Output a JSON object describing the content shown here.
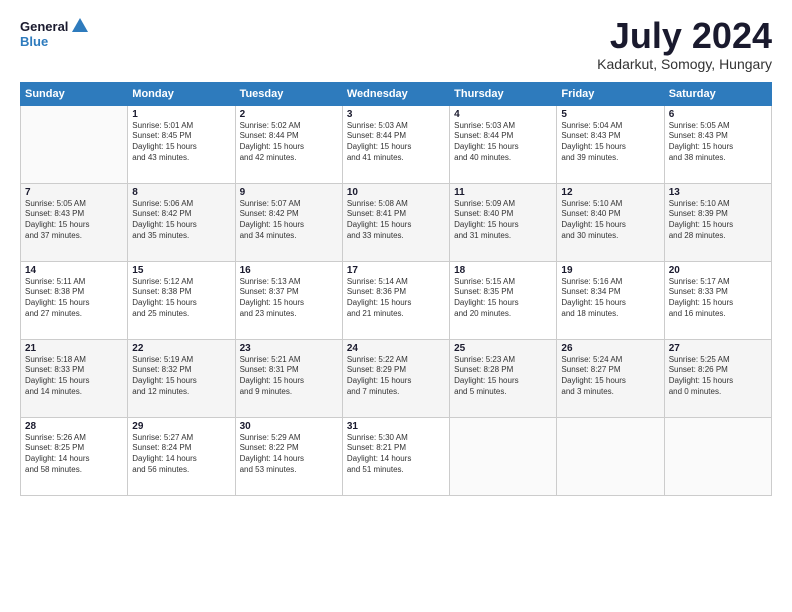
{
  "header": {
    "logo_line1": "General",
    "logo_line2": "Blue",
    "month_title": "July 2024",
    "subtitle": "Kadarkut, Somogy, Hungary"
  },
  "weekdays": [
    "Sunday",
    "Monday",
    "Tuesday",
    "Wednesday",
    "Thursday",
    "Friday",
    "Saturday"
  ],
  "weeks": [
    [
      {
        "day": "",
        "sunrise": "",
        "sunset": "",
        "daylight": ""
      },
      {
        "day": "1",
        "sunrise": "Sunrise: 5:01 AM",
        "sunset": "Sunset: 8:45 PM",
        "daylight": "Daylight: 15 hours and 43 minutes."
      },
      {
        "day": "2",
        "sunrise": "Sunrise: 5:02 AM",
        "sunset": "Sunset: 8:44 PM",
        "daylight": "Daylight: 15 hours and 42 minutes."
      },
      {
        "day": "3",
        "sunrise": "Sunrise: 5:03 AM",
        "sunset": "Sunset: 8:44 PM",
        "daylight": "Daylight: 15 hours and 41 minutes."
      },
      {
        "day": "4",
        "sunrise": "Sunrise: 5:03 AM",
        "sunset": "Sunset: 8:44 PM",
        "daylight": "Daylight: 15 hours and 40 minutes."
      },
      {
        "day": "5",
        "sunrise": "Sunrise: 5:04 AM",
        "sunset": "Sunset: 8:43 PM",
        "daylight": "Daylight: 15 hours and 39 minutes."
      },
      {
        "day": "6",
        "sunrise": "Sunrise: 5:05 AM",
        "sunset": "Sunset: 8:43 PM",
        "daylight": "Daylight: 15 hours and 38 minutes."
      }
    ],
    [
      {
        "day": "7",
        "sunrise": "Sunrise: 5:05 AM",
        "sunset": "Sunset: 8:43 PM",
        "daylight": "Daylight: 15 hours and 37 minutes."
      },
      {
        "day": "8",
        "sunrise": "Sunrise: 5:06 AM",
        "sunset": "Sunset: 8:42 PM",
        "daylight": "Daylight: 15 hours and 35 minutes."
      },
      {
        "day": "9",
        "sunrise": "Sunrise: 5:07 AM",
        "sunset": "Sunset: 8:42 PM",
        "daylight": "Daylight: 15 hours and 34 minutes."
      },
      {
        "day": "10",
        "sunrise": "Sunrise: 5:08 AM",
        "sunset": "Sunset: 8:41 PM",
        "daylight": "Daylight: 15 hours and 33 minutes."
      },
      {
        "day": "11",
        "sunrise": "Sunrise: 5:09 AM",
        "sunset": "Sunset: 8:40 PM",
        "daylight": "Daylight: 15 hours and 31 minutes."
      },
      {
        "day": "12",
        "sunrise": "Sunrise: 5:10 AM",
        "sunset": "Sunset: 8:40 PM",
        "daylight": "Daylight: 15 hours and 30 minutes."
      },
      {
        "day": "13",
        "sunrise": "Sunrise: 5:10 AM",
        "sunset": "Sunset: 8:39 PM",
        "daylight": "Daylight: 15 hours and 28 minutes."
      }
    ],
    [
      {
        "day": "14",
        "sunrise": "Sunrise: 5:11 AM",
        "sunset": "Sunset: 8:38 PM",
        "daylight": "Daylight: 15 hours and 27 minutes."
      },
      {
        "day": "15",
        "sunrise": "Sunrise: 5:12 AM",
        "sunset": "Sunset: 8:38 PM",
        "daylight": "Daylight: 15 hours and 25 minutes."
      },
      {
        "day": "16",
        "sunrise": "Sunrise: 5:13 AM",
        "sunset": "Sunset: 8:37 PM",
        "daylight": "Daylight: 15 hours and 23 minutes."
      },
      {
        "day": "17",
        "sunrise": "Sunrise: 5:14 AM",
        "sunset": "Sunset: 8:36 PM",
        "daylight": "Daylight: 15 hours and 21 minutes."
      },
      {
        "day": "18",
        "sunrise": "Sunrise: 5:15 AM",
        "sunset": "Sunset: 8:35 PM",
        "daylight": "Daylight: 15 hours and 20 minutes."
      },
      {
        "day": "19",
        "sunrise": "Sunrise: 5:16 AM",
        "sunset": "Sunset: 8:34 PM",
        "daylight": "Daylight: 15 hours and 18 minutes."
      },
      {
        "day": "20",
        "sunrise": "Sunrise: 5:17 AM",
        "sunset": "Sunset: 8:33 PM",
        "daylight": "Daylight: 15 hours and 16 minutes."
      }
    ],
    [
      {
        "day": "21",
        "sunrise": "Sunrise: 5:18 AM",
        "sunset": "Sunset: 8:33 PM",
        "daylight": "Daylight: 15 hours and 14 minutes."
      },
      {
        "day": "22",
        "sunrise": "Sunrise: 5:19 AM",
        "sunset": "Sunset: 8:32 PM",
        "daylight": "Daylight: 15 hours and 12 minutes."
      },
      {
        "day": "23",
        "sunrise": "Sunrise: 5:21 AM",
        "sunset": "Sunset: 8:31 PM",
        "daylight": "Daylight: 15 hours and 9 minutes."
      },
      {
        "day": "24",
        "sunrise": "Sunrise: 5:22 AM",
        "sunset": "Sunset: 8:29 PM",
        "daylight": "Daylight: 15 hours and 7 minutes."
      },
      {
        "day": "25",
        "sunrise": "Sunrise: 5:23 AM",
        "sunset": "Sunset: 8:28 PM",
        "daylight": "Daylight: 15 hours and 5 minutes."
      },
      {
        "day": "26",
        "sunrise": "Sunrise: 5:24 AM",
        "sunset": "Sunset: 8:27 PM",
        "daylight": "Daylight: 15 hours and 3 minutes."
      },
      {
        "day": "27",
        "sunrise": "Sunrise: 5:25 AM",
        "sunset": "Sunset: 8:26 PM",
        "daylight": "Daylight: 15 hours and 0 minutes."
      }
    ],
    [
      {
        "day": "28",
        "sunrise": "Sunrise: 5:26 AM",
        "sunset": "Sunset: 8:25 PM",
        "daylight": "Daylight: 14 hours and 58 minutes."
      },
      {
        "day": "29",
        "sunrise": "Sunrise: 5:27 AM",
        "sunset": "Sunset: 8:24 PM",
        "daylight": "Daylight: 14 hours and 56 minutes."
      },
      {
        "day": "30",
        "sunrise": "Sunrise: 5:29 AM",
        "sunset": "Sunset: 8:22 PM",
        "daylight": "Daylight: 14 hours and 53 minutes."
      },
      {
        "day": "31",
        "sunrise": "Sunrise: 5:30 AM",
        "sunset": "Sunset: 8:21 PM",
        "daylight": "Daylight: 14 hours and 51 minutes."
      },
      {
        "day": "",
        "sunrise": "",
        "sunset": "",
        "daylight": ""
      },
      {
        "day": "",
        "sunrise": "",
        "sunset": "",
        "daylight": ""
      },
      {
        "day": "",
        "sunrise": "",
        "sunset": "",
        "daylight": ""
      }
    ]
  ]
}
